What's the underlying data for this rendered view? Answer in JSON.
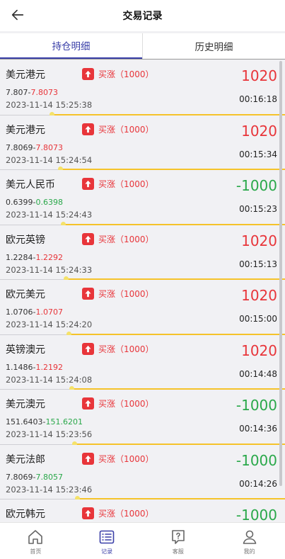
{
  "header": {
    "title": "交易记录"
  },
  "tabs": [
    {
      "label": "持仓明细",
      "active": true
    },
    {
      "label": "历史明细",
      "active": false
    }
  ],
  "records": [
    {
      "name": "美元港元",
      "action": "买涨（1000）",
      "open": "7.807",
      "current": "7.8073",
      "dir": "up",
      "time": "2023-11-14 15:25:38",
      "pnl": "1020",
      "pnl_dir": "up",
      "remain": "00:16:18",
      "progress": 0.18
    },
    {
      "name": "美元港元",
      "action": "买涨（1000）",
      "open": "7.8069",
      "current": "7.8073",
      "dir": "up",
      "time": "2023-11-14 15:24:54",
      "pnl": "1020",
      "pnl_dir": "up",
      "remain": "00:15:34",
      "progress": 0.21
    },
    {
      "name": "美元人民币",
      "action": "买涨（1000）",
      "open": "0.6399",
      "current": "0.6398",
      "dir": "down",
      "time": "2023-11-14 15:24:43",
      "pnl": "-1000",
      "pnl_dir": "down",
      "remain": "00:15:23",
      "progress": 0.22
    },
    {
      "name": "欧元英镑",
      "action": "买涨（1000）",
      "open": "1.2284",
      "current": "1.2292",
      "dir": "up",
      "time": "2023-11-14 15:24:33",
      "pnl": "1020",
      "pnl_dir": "up",
      "remain": "00:15:13",
      "progress": 0.23
    },
    {
      "name": "欧元美元",
      "action": "买涨（1000）",
      "open": "1.0706",
      "current": "1.0707",
      "dir": "up",
      "time": "2023-11-14 15:24:20",
      "pnl": "1020",
      "pnl_dir": "up",
      "remain": "00:15:00",
      "progress": 0.24
    },
    {
      "name": "英镑澳元",
      "action": "买涨（1000）",
      "open": "1.1486",
      "current": "1.2192",
      "dir": "up",
      "time": "2023-11-14 15:24:08",
      "pnl": "1020",
      "pnl_dir": "up",
      "remain": "00:14:48",
      "progress": 0.25
    },
    {
      "name": "美元澳元",
      "action": "买涨（1000）",
      "open": "151.6403",
      "current": "151.6201",
      "dir": "down",
      "time": "2023-11-14 15:23:56",
      "pnl": "-1000",
      "pnl_dir": "down",
      "remain": "00:14:36",
      "progress": 0.26
    },
    {
      "name": "美元法郎",
      "action": "买涨（1000）",
      "open": "7.8069",
      "current": "7.8057",
      "dir": "down",
      "time": "2023-11-14 15:23:46",
      "pnl": "-1000",
      "pnl_dir": "down",
      "remain": "00:14:26",
      "progress": 0.27
    },
    {
      "name": "欧元韩元",
      "action": "买涨（1000）",
      "open": "",
      "current": "",
      "dir": "down",
      "time": "",
      "pnl": "-1000",
      "pnl_dir": "down",
      "remain": "",
      "progress": 0
    }
  ],
  "bottom_nav": [
    {
      "label": "首页",
      "icon": "home-icon",
      "active": false
    },
    {
      "label": "记录",
      "icon": "list-icon",
      "active": true
    },
    {
      "label": "客服",
      "icon": "help-icon",
      "active": false
    },
    {
      "label": "我的",
      "icon": "user-icon",
      "active": false
    }
  ],
  "colors": {
    "up": "#e8353a",
    "down": "#2aa84a",
    "accent": "#3a3fa8",
    "progress": "#f5c32a"
  }
}
